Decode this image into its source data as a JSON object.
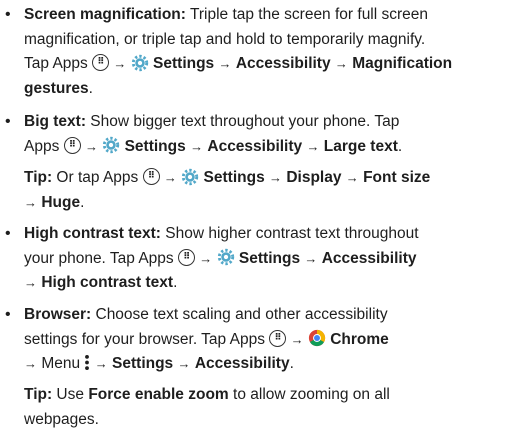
{
  "icons": {
    "apps": "apps-grid-icon",
    "settings": "settings-gear-icon",
    "chrome": "chrome-browser-icon",
    "menu": "vertical-dots-menu-icon",
    "arrow": "→"
  },
  "colors": {
    "text": "#1e1e1e",
    "gear": "#52a8c9",
    "chrome_red": "#db4437",
    "chrome_yellow": "#f4b400",
    "chrome_green": "#0f9d58",
    "chrome_blue": "#4285f4"
  },
  "bullet": "•",
  "items": {
    "magnification": {
      "title": "Screen magnification:",
      "line1_text": " Triple tap the screen for full screen",
      "line2_text": "magnification, or triple tap and hold to temporarily magnify.",
      "tap_apps": "Tap Apps",
      "settings": "Settings",
      "accessibility": "Accessibility",
      "magnification": "Magnification",
      "gestures": "gestures",
      "end": "."
    },
    "bigtext": {
      "title": "Big text:",
      "line1_text": " Show bigger text throughout your phone. Tap",
      "apps": "Apps",
      "settings": "Settings",
      "accessibility": "Accessibility",
      "large_text": "Large text",
      "end": "."
    },
    "tip1": {
      "label": "Tip:",
      "text": " Or tap Apps",
      "settings": "Settings",
      "display": "Display",
      "font_size": "Font size",
      "huge": "Huge",
      "end": "."
    },
    "contrast": {
      "title": "High contrast text:",
      "line1_text": " Show higher contrast text throughout",
      "line2_text": "your phone. Tap Apps",
      "settings": "Settings",
      "accessibility": "Accessibility",
      "high_contrast": "High contrast text",
      "end": "."
    },
    "browser": {
      "title": "Browser:",
      "line1_text": " Choose text scaling and other accessibility",
      "line2_text": "settings for your browser. Tap Apps",
      "chrome": "Chrome",
      "menu": "Menu",
      "settings": "Settings",
      "accessibility": "Accessibility",
      "end": "."
    },
    "tip2": {
      "label": "Tip:",
      "text1": " Use ",
      "force": "Force enable zoom",
      "text2": " to allow zooming on all",
      "text3": "webpages."
    }
  }
}
